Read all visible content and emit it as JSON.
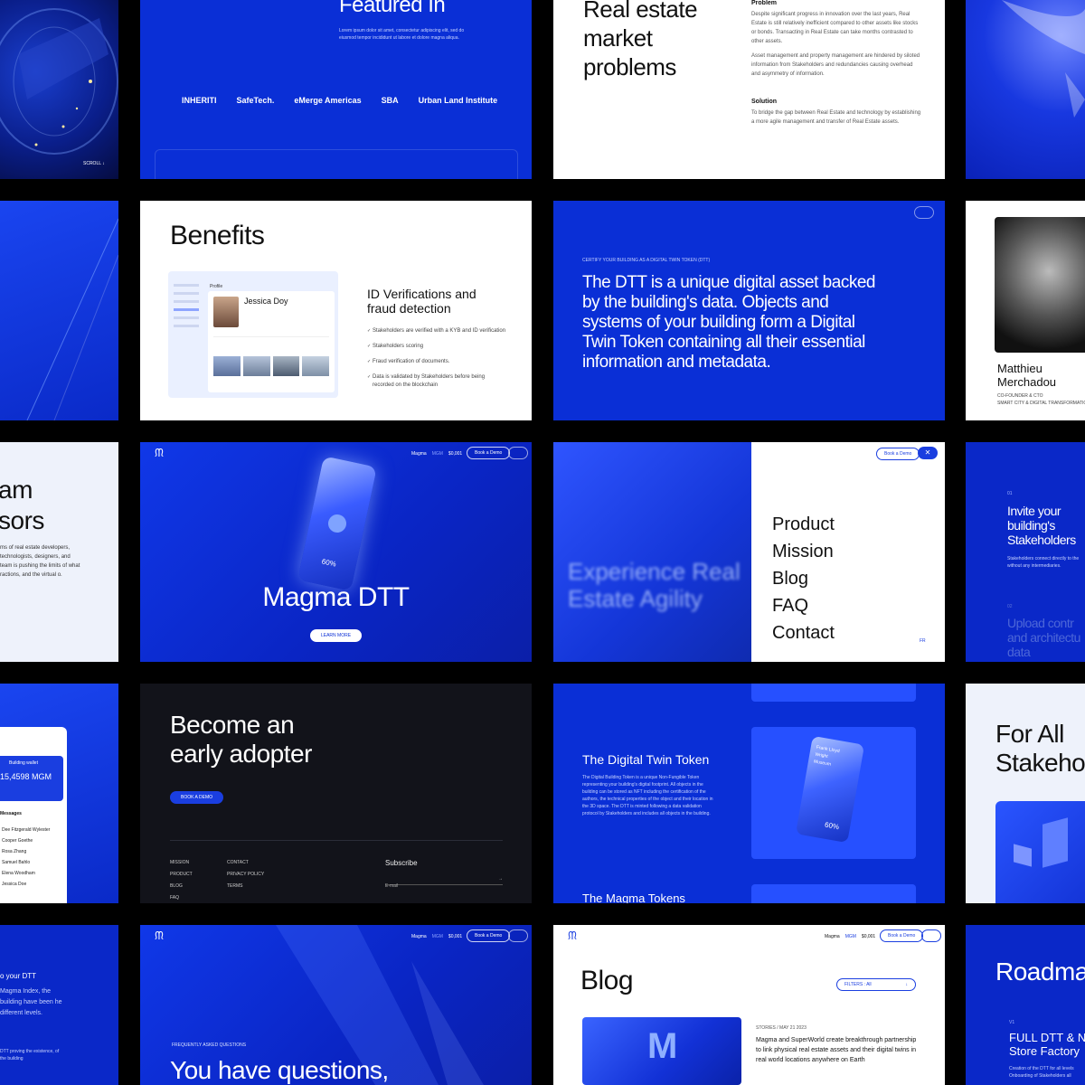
{
  "featured": {
    "title": "Featured In",
    "body": "Lorem ipsum dolor sit amet, consectetur adipiscing elit, sed do eiusmod tempor incididunt ut labore et dolore magna aliqua.",
    "logos": [
      "INHERITI",
      "SafeTech.",
      "eMerge Americas",
      "SBA",
      "Urban Land Institute"
    ]
  },
  "scroll": {
    "label": "SCROLL ↓"
  },
  "problems": {
    "title": "Real estate market problems",
    "problem_heading": "Problem",
    "problem_p1": "Despite significant progress in innovation over the last years, Real Estate is still relatively inefficient compared to other assets like stocks or bonds. Transacting in Real Estate can take months contrasted to other assets.",
    "problem_p2": "Asset management and property management are hindered by siloted information from Stakeholders and redundancies causing overhead and asymmetry of information.",
    "solution_heading": "Solution",
    "solution_p": "To bridge the gap between Real Estate and technology by establishing a more agile management and transfer of Real Estate assets."
  },
  "benefits": {
    "title": "Benefits",
    "profile_name": "Jessica Doy",
    "profile_tab": "Profile",
    "id_title": "ID Verifications and fraud detection",
    "items": [
      "Stakeholders are verified with a KYB and ID verification",
      "Stakeholders scoring",
      "Fraud verification of documents.",
      "Data is validated by Stakeholders before being recorded on the blockchain"
    ]
  },
  "dtt": {
    "kicker": "CERTIFY YOUR BUILDING AS A DIGITAL TWIN TOKEN (DTT)",
    "text": "The DTT is a unique digital asset backed by the building's data. Objects and systems of your building form a Digital Twin Token containing all their essential information and metadata."
  },
  "person": {
    "name": "Matthieu Merchadou",
    "role": "CO-FOUNDER & CTO",
    "role2": "SMART CITY & DIGITAL TRANSFORMATION E"
  },
  "team": {
    "title_line1": "am",
    "title_line2": "sors",
    "body": "ms of real estate developers, technologists, designers, and team is pushing the limits of what ractions, and the virtual o."
  },
  "hero": {
    "nav_brand": "Magma",
    "nav_token": "MGM",
    "nav_price": "$0,001",
    "book_demo": "Book a Demo",
    "title": "Magma DTT",
    "learn_more": "LEARN MORE",
    "card_percent": "60%"
  },
  "menu": {
    "bg_text": "Experience Real Estate Agility",
    "book_demo": "Book a Demo",
    "items": [
      "Product",
      "Mission",
      "Blog",
      "FAQ",
      "Contact"
    ],
    "lang": "FR"
  },
  "invite": {
    "step1": "01",
    "title": "Invite your building's Stakeholders",
    "body": "Stakeholders connect directly to the without any intermediaries.",
    "step2": "02",
    "title2": "Upload contr and architectu data"
  },
  "wallet": {
    "title": "Building wallet",
    "balance": "15,4598 MGM",
    "messages_label": "Messages",
    "contacts": [
      "Dee Fitzgerald Wylester",
      "Cooper Goethe",
      "Rosa Zhang",
      "Samuel Bahlo",
      "Elena Woodham",
      "Jessica Doe"
    ]
  },
  "adopter": {
    "title": "Become an early adopter",
    "cta": "BOOK A DEMO",
    "col1": [
      "MISSION",
      "PRODUCT",
      "BLOG",
      "FAQ"
    ],
    "col2": [
      "CONTACT",
      "PRIVACY POLICY",
      "TERMS"
    ],
    "subscribe": "Subscribe",
    "email_placeholder": "E-mail"
  },
  "token": {
    "title": "The Digital Twin Token",
    "body": "The Digital Building Token is a unique Non-Fungible Token representing your building's digital footprint. All objects in the building can be stored as NFT including the certification of the authors, the technical properties of the object and their location in the 3D space. The DTT is minted following a data validation protocol by Stakeholders and includes all objects in the building.",
    "card_title": "Frank Lloyd Wright Museum",
    "card_percent": "60%",
    "next_title": "The Magma Tokens"
  },
  "stake": {
    "title": "For All Stakehol"
  },
  "dttidx": {
    "title": "o your DTT",
    "body": "Magma Index, the building have been he different levels.",
    "body2": "DTT proving the existence, of the building"
  },
  "faq": {
    "kicker": "FREQUENTLY ASKED QUESTIONS",
    "title": "You have questions,",
    "nav_brand": "Magma",
    "nav_token": "MGM",
    "nav_price": "$0,001",
    "book_demo": "Book a Demo"
  },
  "blog": {
    "title": "Blog",
    "filter": "FILTERS : All",
    "nav_brand": "Magma",
    "nav_token": "MGM",
    "nav_price": "$0,001",
    "book_demo": "Book a Demo",
    "post_meta": "STORIES / MAY 21 2023",
    "post_title": "Magma and SuperWorld create breakthrough partnership to link physical real estate assets and their digital twins in real world locations anywhere on Earth"
  },
  "roadmap": {
    "title": "Roadma",
    "step": "V1",
    "item": "FULL DTT & N Store Factory",
    "body": "Creation of the DTT for all levels Onboarding of Stakeholders all"
  }
}
